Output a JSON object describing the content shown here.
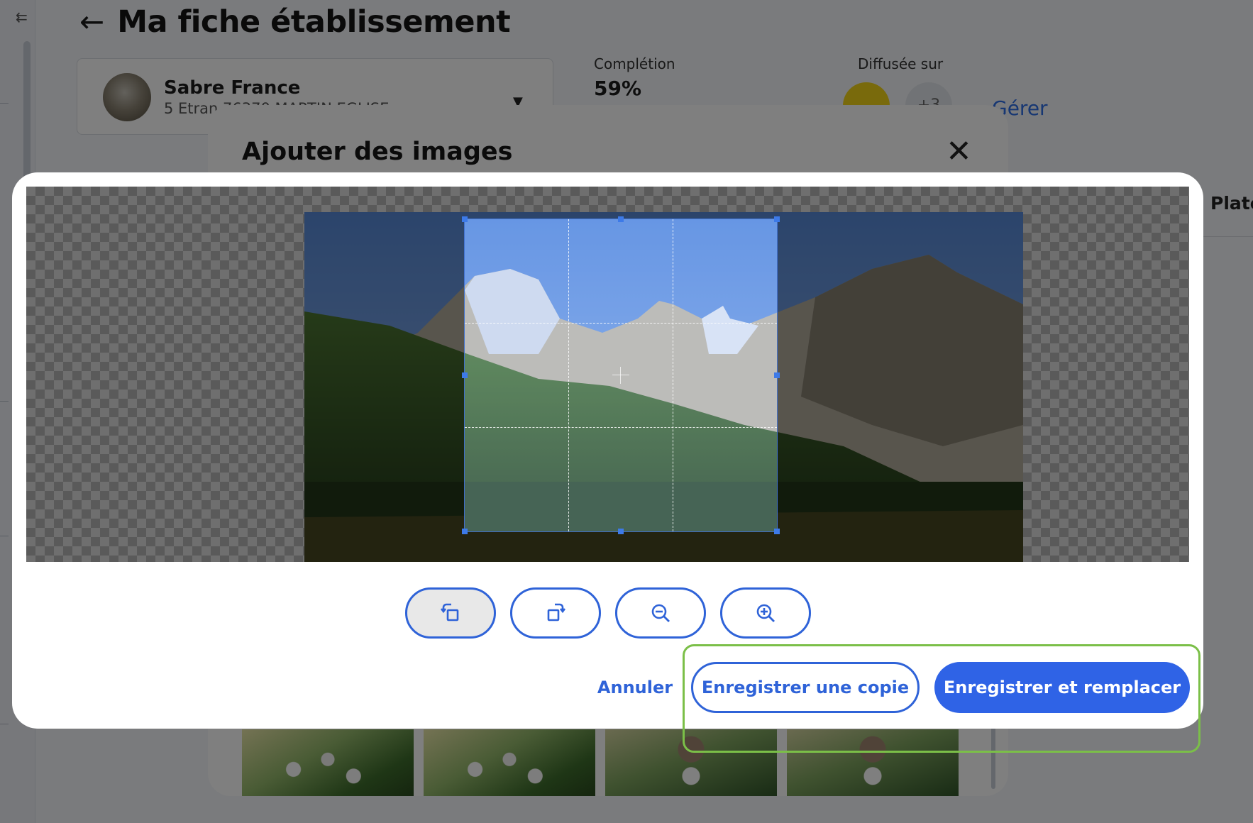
{
  "page": {
    "title": "Ma fiche établissement",
    "establishment": {
      "name": "Sabre France",
      "address": "5 Etran 76370 MARTIN EGLISE"
    },
    "completion": {
      "label": "Complétion",
      "value": "59%"
    },
    "diffusion": {
      "label": "Diffusée sur",
      "more_count": "+3",
      "manage_link": "Gérer"
    },
    "tab_partial": "Plate"
  },
  "add_images_modal": {
    "title": "Ajouter des images"
  },
  "crop_modal": {
    "tools": [
      {
        "name": "rotate-left-icon"
      },
      {
        "name": "rotate-right-icon"
      },
      {
        "name": "zoom-out-icon"
      },
      {
        "name": "zoom-in-icon"
      }
    ],
    "cancel_label": "Annuler",
    "save_copy_label": "Enregistrer une copie",
    "save_replace_label": "Enregistrer et remplacer"
  },
  "colors": {
    "primary": "#2f63e6",
    "highlight": "#7bbf48"
  }
}
